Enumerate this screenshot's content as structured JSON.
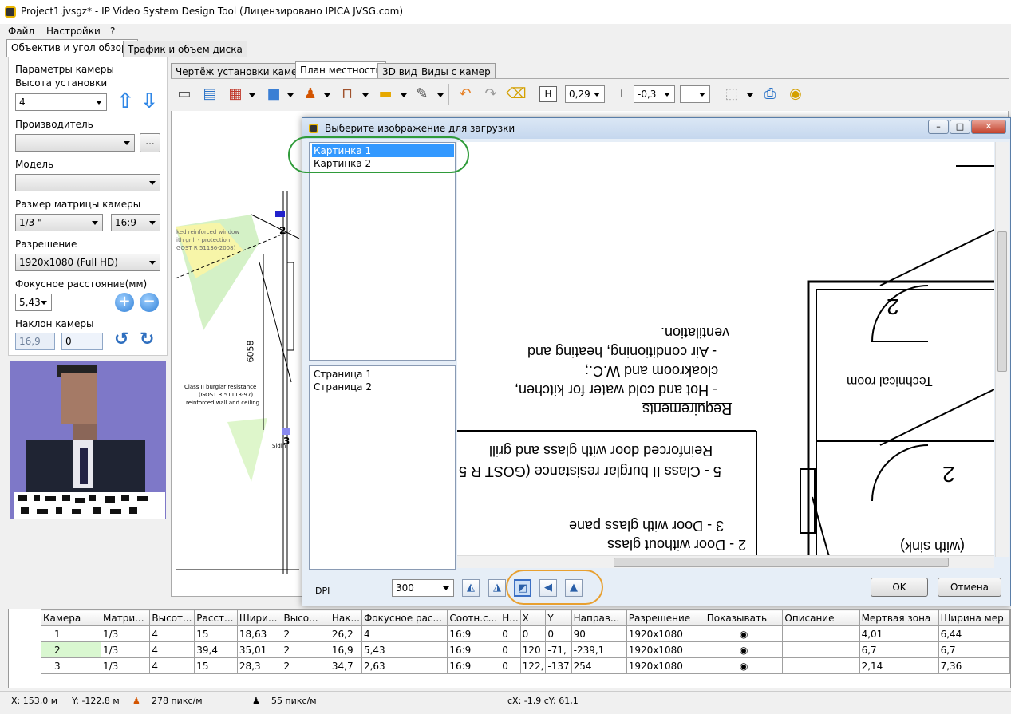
{
  "window": {
    "title": "Project1.jvsgz* - IP Video System Design Tool (Лицензировано  IPICA JVSG.com)"
  },
  "menu": [
    "Файл",
    "Настройки",
    "?"
  ],
  "left_tabs": [
    "Объектив и угол обзора",
    "Трафик и объем диска"
  ],
  "camera_params": {
    "group_title": "Параметры камеры",
    "height_label": "Высота установки",
    "height_value": "4",
    "manufacturer_label": "Производитель",
    "manufacturer_value": "",
    "browse_label": "...",
    "model_label": "Модель",
    "model_value": "",
    "sensor_label": "Размер матрицы камеры",
    "sensor_value": "1/3 \"",
    "aspect_value": "16:9",
    "resolution_label": "Разрешение",
    "resolution_value": "1920x1080 (Full HD)",
    "focal_label": "Фокусное расстояние(мм)",
    "focal_value": "5,43",
    "tilt_label": "Наклон камеры",
    "tilt_value": "16,9",
    "tilt_value2": "0"
  },
  "view_tabs": [
    "Чертёж установки камеры",
    "План местности",
    "3D вид",
    "Виды с камер"
  ],
  "toolbar": {
    "height_value": "0,29",
    "offset_value": "-0,3",
    "h_icon_text": "H"
  },
  "plan_labels": {
    "dim": "6058",
    "num2": "2",
    "num3": "3",
    "note1": "ked reinforced window",
    "note2": "ith grill - protection",
    "note3": "GOST R 51136-2008)",
    "note4": "Class II burglar resistance",
    "note5": "(GOST R 51113-97)",
    "note6": "reinforced wall and ceiling",
    "note7": "Sidin"
  },
  "dialog": {
    "title": "Выберите изображение для загрузки",
    "images": [
      "Картинка 1",
      "Картинка 2"
    ],
    "pages": [
      "Страница 1",
      "Страница 2"
    ],
    "dpi_label": "DPI",
    "dpi_value": "300",
    "ok": "OK",
    "cancel": "Отмена",
    "preview_text": {
      "vent": "ventilation.",
      "air": "- Air conditioning, heating and",
      "cloak": "cloakroom and W.C.;",
      "hot": "- Hot and cold water for kitchen,",
      "req": "Requirements",
      "tech": "Technical room",
      "reinf": "Reinforced door with glass and grill",
      "cls": "5 - Class II burglar resistance (GOST R 5",
      "door3": "3 - Door with glass pane",
      "door2a": "2 - Door without glass",
      "sink": "(with sink)",
      "two": "2"
    }
  },
  "grid": {
    "columns": [
      "Камера",
      "Матри...",
      "Высот...",
      "Расст...",
      "Шири...",
      "Высо...",
      "Нак...",
      "Фокусное рас...",
      "Соотн.с...",
      "Н...",
      "X",
      "Y",
      "Направ...",
      "Разрешение",
      "Показывать",
      "Описание",
      "Мертвая зона",
      "Ширина мер"
    ],
    "rows": [
      [
        "1",
        "1/3",
        "4",
        "15",
        "18,63",
        "2",
        "26,2",
        "4",
        "16:9",
        "0",
        "0",
        "0",
        "90",
        "1920x1080",
        "",
        "",
        "4,01",
        "6,44"
      ],
      [
        "2",
        "1/3",
        "4",
        "39,4",
        "35,01",
        "2",
        "16,9",
        "5,43",
        "16:9",
        "0",
        "120",
        "-239,1",
        "-71,",
        "1920x1080",
        "",
        "",
        "6,7",
        "6,7"
      ],
      [
        "3",
        "1/3",
        "4",
        "15",
        "28,3",
        "2",
        "34,7",
        "2,63",
        "16:9",
        "0",
        "122,",
        "-137",
        "254",
        "1920x1080",
        "",
        "",
        "2,14",
        "7,36"
      ]
    ]
  },
  "status": {
    "x": "X: 153,0 м",
    "y": "Y: -122,8 м",
    "px1": "278 пикс/м",
    "px2": "55 пикс/м",
    "cxy": "cX: -1,9 cY: 61,1"
  },
  "colors": {
    "highlight_green": "#2f9b3a",
    "highlight_orange": "#e8a030",
    "selection": "#3399ff"
  }
}
